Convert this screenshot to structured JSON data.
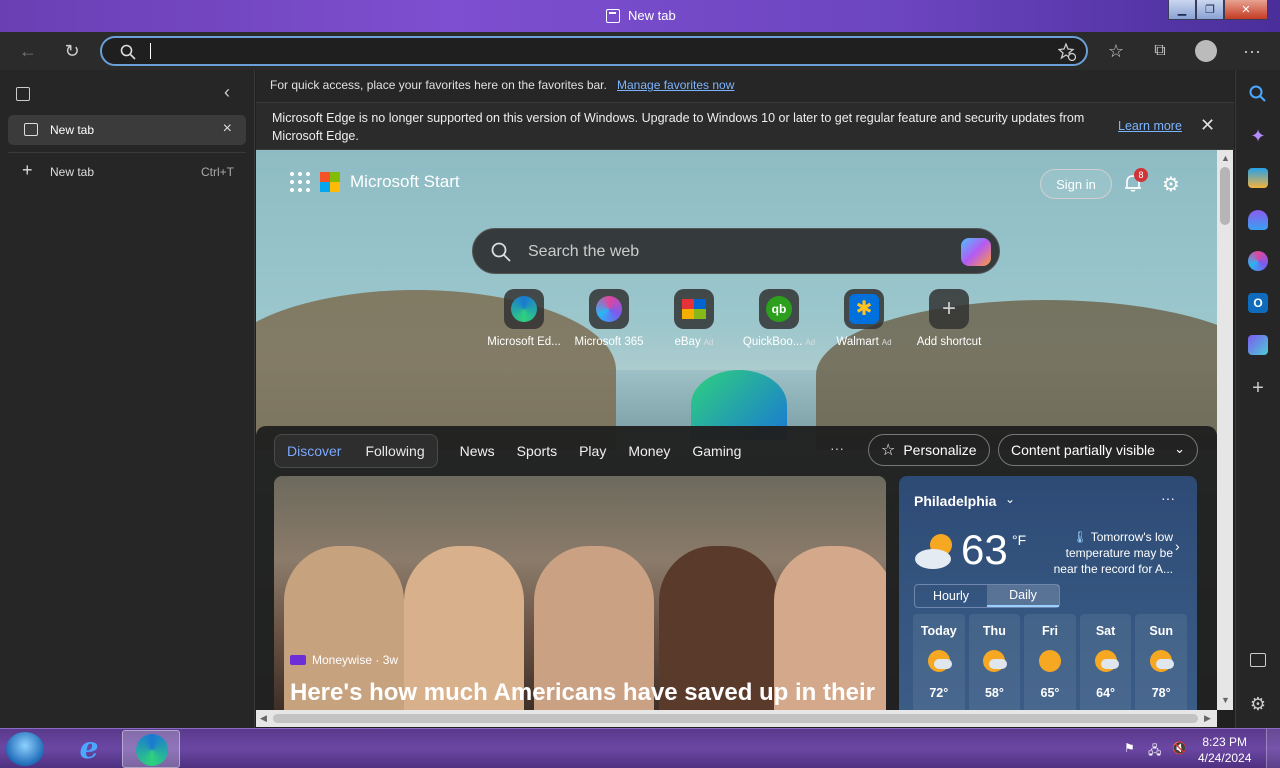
{
  "window": {
    "title": "New tab"
  },
  "toolbar": {
    "address_value": ""
  },
  "vertical_tabs": {
    "active_tab": "New tab",
    "new_tab_label": "New tab",
    "new_tab_shortcut": "Ctrl+T"
  },
  "favorites_bar": {
    "text": "For quick access, place your favorites here on the favorites bar.",
    "link": "Manage favorites now"
  },
  "infobar": {
    "message": "Microsoft Edge is no longer supported on this version of Windows. Upgrade to Windows 10 or later to get regular feature and security updates from Microsoft Edge.",
    "link": "Learn more"
  },
  "start_page": {
    "brand": "Microsoft Start",
    "sign_in": "Sign in",
    "notification_count": "8",
    "search_placeholder": "Search the web",
    "shortcuts": [
      {
        "label": "Microsoft Ed...",
        "ad": ""
      },
      {
        "label": "Microsoft 365",
        "ad": ""
      },
      {
        "label": "eBay",
        "ad": "Ad"
      },
      {
        "label": "QuickBoo...",
        "ad": "Ad"
      },
      {
        "label": "Walmart",
        "ad": "Ad"
      },
      {
        "label": "Add shortcut",
        "ad": ""
      }
    ],
    "feed_tabs": [
      "Discover",
      "Following"
    ],
    "nav": [
      "News",
      "Sports",
      "Play",
      "Money",
      "Gaming"
    ],
    "more": "···",
    "personalize": "Personalize",
    "content_visibility": "Content partially visible",
    "hero": {
      "source": "Moneywise · 3w",
      "headline": "Here's how much Americans have saved up in their"
    },
    "weather": {
      "city": "Philadelphia",
      "temp": "63",
      "unit": "°F",
      "note": "Tomorrow's low temperature may be near the record for A...",
      "toggle": [
        "Hourly",
        "Daily"
      ],
      "days": [
        {
          "name": "Today",
          "high": "72°"
        },
        {
          "name": "Thu",
          "high": "58°"
        },
        {
          "name": "Fri",
          "high": "65°"
        },
        {
          "name": "Sat",
          "high": "64°"
        },
        {
          "name": "Sun",
          "high": "78°"
        }
      ]
    }
  },
  "taskbar": {
    "time": "8:23 PM",
    "date": "4/24/2024"
  }
}
